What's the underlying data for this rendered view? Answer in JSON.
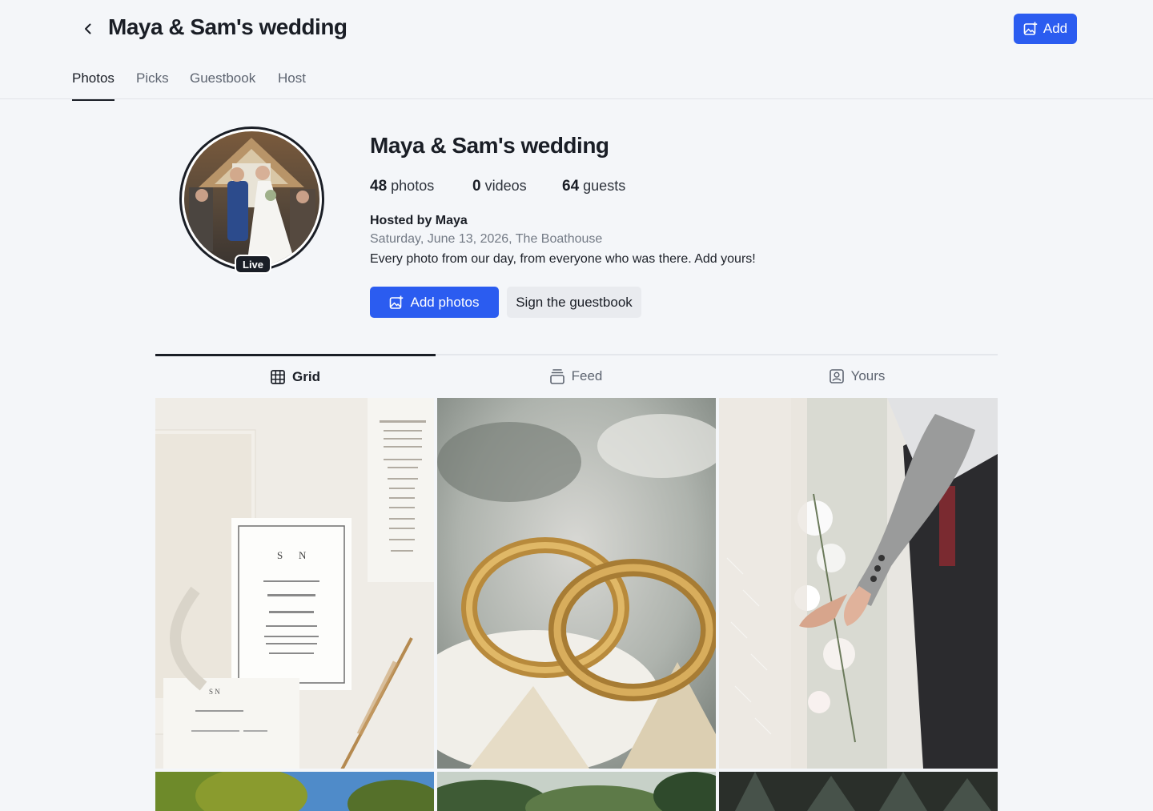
{
  "header": {
    "title": "Maya & Sam's wedding",
    "add_label": "Add"
  },
  "main_tabs": [
    {
      "label": "Photos",
      "active": true
    },
    {
      "label": "Picks",
      "active": false
    },
    {
      "label": "Guestbook",
      "active": false
    },
    {
      "label": "Host",
      "active": false
    }
  ],
  "profile": {
    "name": "Maya & Sam's wedding",
    "badge": "Live",
    "stats": {
      "photos_count": "48",
      "photos_label": "photos",
      "videos_count": "0",
      "videos_label": "videos",
      "guests_count": "64",
      "guests_label": "guests"
    },
    "hosted_by": "Hosted by Maya",
    "date_venue": "Saturday, June 13, 2026, The Boathouse",
    "description": "Every photo from our day, from everyone who was there. Add yours!",
    "add_photos_label": "Add photos",
    "guestbook_label": "Sign the guestbook"
  },
  "view_tabs": [
    {
      "label": "Grid",
      "icon": "grid-icon",
      "active": true
    },
    {
      "label": "Feed",
      "icon": "feed-icon",
      "active": false
    },
    {
      "label": "Yours",
      "icon": "user-portrait-icon",
      "active": false
    }
  ],
  "photos": [
    {
      "subject": "wedding-invitation"
    },
    {
      "subject": "gold-rings"
    },
    {
      "subject": "couple-holding-hands"
    },
    {
      "subject": "trees-sky"
    },
    {
      "subject": "greenery"
    },
    {
      "subject": "forest"
    }
  ],
  "colors": {
    "accent": "#2b5cf0",
    "text": "#1a1e26",
    "background": "#f4f6f9"
  }
}
